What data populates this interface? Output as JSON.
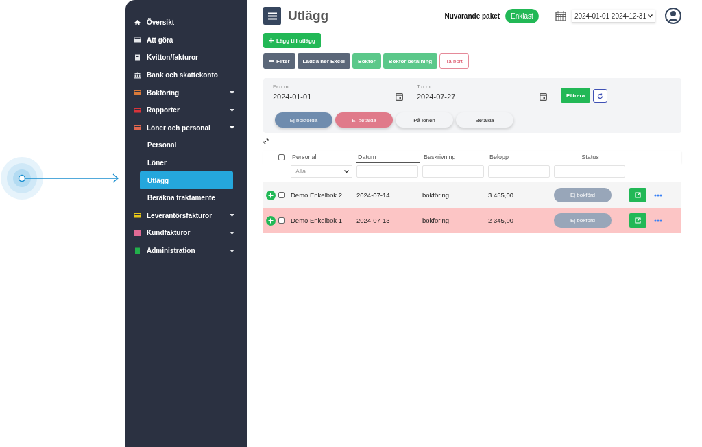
{
  "sidebar": {
    "items": [
      {
        "label": "Översikt",
        "kind": "link",
        "color": "#ffffff"
      },
      {
        "label": "Att göra",
        "kind": "link",
        "color": "#e5e7eb"
      },
      {
        "label": "Kvitton/fakturor",
        "kind": "link",
        "color": "#e5e7eb"
      },
      {
        "label": "Bank och skattekonto",
        "kind": "link",
        "color": "#e5e7eb"
      },
      {
        "label": "Bokföring",
        "kind": "group",
        "color": "#d97a3a",
        "expanded": false
      },
      {
        "label": "Rapporter",
        "kind": "group",
        "color": "#d9343a",
        "expanded": false
      },
      {
        "label": "Löner och personal",
        "kind": "group",
        "color": "#e0674f",
        "expanded": true,
        "children": [
          {
            "label": "Personal",
            "selected": false
          },
          {
            "label": "Löner",
            "selected": false
          },
          {
            "label": "Utlägg",
            "selected": true
          },
          {
            "label": "Beräkna traktamente",
            "selected": false
          }
        ]
      },
      {
        "label": "Leverantörsfakturor",
        "kind": "group",
        "color": "#e6c619",
        "expanded": false
      },
      {
        "label": "Kundfakturor",
        "kind": "group",
        "color": "#e06a94",
        "expanded": false
      },
      {
        "label": "Administration",
        "kind": "group",
        "color": "#22b04b",
        "expanded": false
      }
    ]
  },
  "header": {
    "title": "Utlägg",
    "package_label": "Nuvarande paket",
    "package": "Enklast",
    "period": "2024-01-01 2024-12-31"
  },
  "add_button": "Lägg till utlägg",
  "toolbar": [
    {
      "label": "Filter",
      "kind": "dark"
    },
    {
      "label": "Ladda ner Excel",
      "kind": "dark"
    },
    {
      "label": "Bokför",
      "kind": "green"
    },
    {
      "label": "Bokför betalning",
      "kind": "green"
    },
    {
      "label": "Ta bort",
      "kind": "outline"
    }
  ],
  "filter": {
    "from_label": "Fr.o.m",
    "from": "2024-01-01",
    "to_label": "T.o.m",
    "to": "2024-07-27",
    "apply": "Filtrera",
    "chips": [
      {
        "label": "Ej bokförda",
        "color": "#6f8cae"
      },
      {
        "label": "Ej betalda",
        "color": "#e07a8a"
      },
      {
        "label": "På lönen",
        "color": "#f3f4f6"
      },
      {
        "label": "Betalda",
        "color": "#f3f4f6"
      }
    ]
  },
  "table": {
    "columns": [
      {
        "label": "Personal",
        "sorted": false
      },
      {
        "label": "Datum",
        "sorted": true
      },
      {
        "label": "Beskrivning",
        "sorted": false
      },
      {
        "label": "Belopp",
        "sorted": false
      },
      {
        "label": "Status",
        "sorted": false
      }
    ],
    "all_checked": false,
    "personal_filter": "Alla",
    "rows": [
      {
        "personal": "Demo Enkelbok 2",
        "datum": "2024-07-14",
        "beskrivning": "bokföring",
        "belopp": "3 455,00",
        "status": "Ej bokförd",
        "checked": false,
        "highlighted": false
      },
      {
        "personal": "Demo Enkelbok 1",
        "datum": "2024-07-13",
        "beskrivning": "bokföring",
        "belopp": "2 345,00",
        "status": "Ej bokförd",
        "checked": false,
        "highlighted": true
      }
    ]
  }
}
